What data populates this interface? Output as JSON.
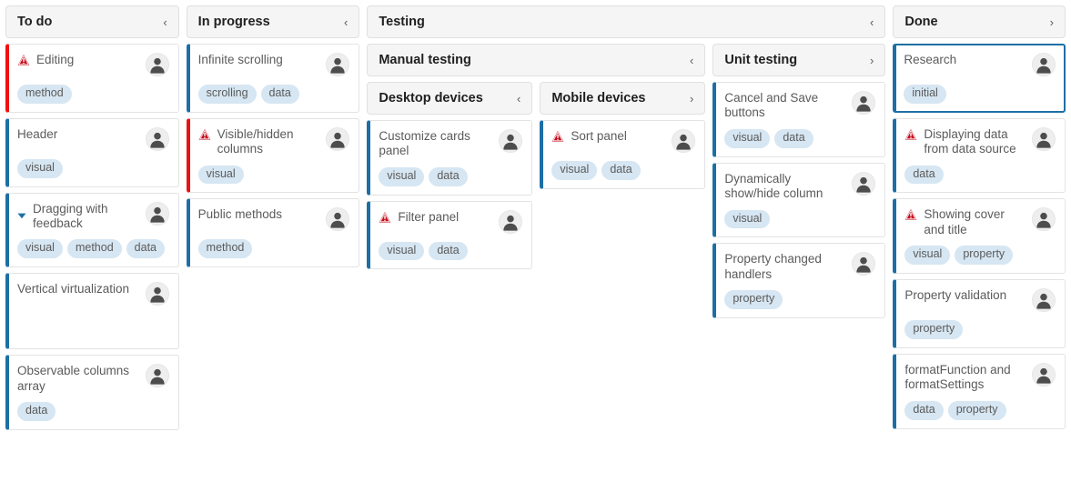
{
  "theme": {
    "accent": "#1d6fa5",
    "priority_high": "#ee1111",
    "tag_bg": "#d6e6f2",
    "header_bg": "#f5f5f5",
    "text": "#5b5b5b"
  },
  "board": {
    "columns": [
      {
        "id": "todo",
        "title": "To do",
        "collapse_icon": "chevron-left-icon",
        "collapse_glyph": "‹",
        "cards": [
          {
            "title": "Editing",
            "priority": "high",
            "warning": true,
            "caret": false,
            "selected": false,
            "avatar": "user-avatar",
            "tags": [
              "method"
            ]
          },
          {
            "title": "Header",
            "priority": "normal",
            "warning": false,
            "caret": false,
            "selected": false,
            "avatar": "user-avatar",
            "tags": [
              "visual"
            ]
          },
          {
            "title": "Dragging with feedback",
            "priority": "normal",
            "warning": false,
            "caret": true,
            "selected": false,
            "avatar": "user-avatar",
            "tags": [
              "visual",
              "method",
              "data"
            ]
          },
          {
            "title": "Vertical virtualization",
            "priority": "normal",
            "warning": false,
            "caret": false,
            "selected": false,
            "avatar": "user-avatar",
            "tags": []
          },
          {
            "title": "Observable columns array",
            "priority": "normal",
            "warning": false,
            "caret": false,
            "selected": false,
            "avatar": "user-avatar",
            "tags": [
              "data"
            ]
          }
        ]
      },
      {
        "id": "inprogress",
        "title": "In progress",
        "collapse_icon": "chevron-left-icon",
        "collapse_glyph": "‹",
        "cards": [
          {
            "title": "Infinite scrolling",
            "priority": "normal",
            "warning": false,
            "caret": false,
            "selected": false,
            "avatar": "user-avatar",
            "tags": [
              "scrolling",
              "data"
            ]
          },
          {
            "title": "Visible/hidden columns",
            "priority": "high",
            "warning": true,
            "caret": false,
            "selected": false,
            "avatar": "user-avatar",
            "tags": [
              "visual"
            ]
          },
          {
            "title": "Public methods",
            "priority": "normal",
            "warning": false,
            "caret": false,
            "selected": false,
            "avatar": "user-avatar",
            "tags": [
              "method"
            ]
          }
        ]
      },
      {
        "id": "testing",
        "title": "Testing",
        "collapse_icon": "chevron-left-icon",
        "collapse_glyph": "‹",
        "subcolumns": [
          {
            "id": "manual-testing",
            "title": "Manual testing",
            "collapse_icon": "chevron-left-icon",
            "collapse_glyph": "‹",
            "subcolumns": [
              {
                "id": "desktop-devices",
                "title": "Desktop devices",
                "collapse_icon": "chevron-left-icon",
                "collapse_glyph": "‹",
                "cards": [
                  {
                    "title": "Customize cards panel",
                    "priority": "normal",
                    "warning": false,
                    "caret": false,
                    "selected": false,
                    "avatar": "user-avatar",
                    "tags": [
                      "visual",
                      "data"
                    ]
                  },
                  {
                    "title": "Filter panel",
                    "priority": "normal",
                    "warning": true,
                    "caret": false,
                    "selected": false,
                    "avatar": "user-avatar",
                    "tags": [
                      "visual",
                      "data"
                    ]
                  }
                ]
              },
              {
                "id": "mobile-devices",
                "title": "Mobile devices",
                "collapse_icon": "chevron-right-icon",
                "collapse_glyph": "›",
                "cards": [
                  {
                    "title": "Sort panel",
                    "priority": "normal",
                    "warning": true,
                    "caret": false,
                    "selected": false,
                    "avatar": "user-avatar",
                    "tags": [
                      "visual",
                      "data"
                    ]
                  }
                ]
              }
            ]
          },
          {
            "id": "unit-testing",
            "title": "Unit testing",
            "collapse_icon": "chevron-right-icon",
            "collapse_glyph": "›",
            "cards": [
              {
                "title": "Cancel and Save buttons",
                "priority": "normal",
                "warning": false,
                "caret": false,
                "selected": false,
                "avatar": "user-avatar",
                "tags": [
                  "visual",
                  "data"
                ]
              },
              {
                "title": "Dynamically show/hide column",
                "priority": "normal",
                "warning": false,
                "caret": false,
                "selected": false,
                "avatar": "user-avatar",
                "tags": [
                  "visual"
                ]
              },
              {
                "title": "Property changed handlers",
                "priority": "normal",
                "warning": false,
                "caret": false,
                "selected": false,
                "avatar": "user-avatar",
                "tags": [
                  "property"
                ]
              }
            ]
          }
        ]
      },
      {
        "id": "done",
        "title": "Done",
        "collapse_icon": "chevron-right-icon",
        "collapse_glyph": "›",
        "cards": [
          {
            "title": "Research",
            "priority": "normal",
            "warning": false,
            "caret": false,
            "selected": true,
            "avatar": "user-avatar",
            "tags": [
              "initial"
            ]
          },
          {
            "title": "Displaying data from data source",
            "priority": "normal",
            "warning": true,
            "caret": false,
            "selected": false,
            "avatar": "user-avatar",
            "tags": [
              "data"
            ]
          },
          {
            "title": "Showing cover and title",
            "priority": "normal",
            "warning": true,
            "caret": false,
            "selected": false,
            "avatar": "user-avatar",
            "tags": [
              "visual",
              "property"
            ]
          },
          {
            "title": "Property validation",
            "priority": "normal",
            "warning": false,
            "caret": false,
            "selected": false,
            "avatar": "user-avatar",
            "tags": [
              "property"
            ]
          },
          {
            "title": "formatFunction and formatSettings",
            "priority": "normal",
            "warning": false,
            "caret": false,
            "selected": false,
            "avatar": "user-avatar",
            "tags": [
              "data",
              "property"
            ]
          }
        ]
      }
    ]
  }
}
